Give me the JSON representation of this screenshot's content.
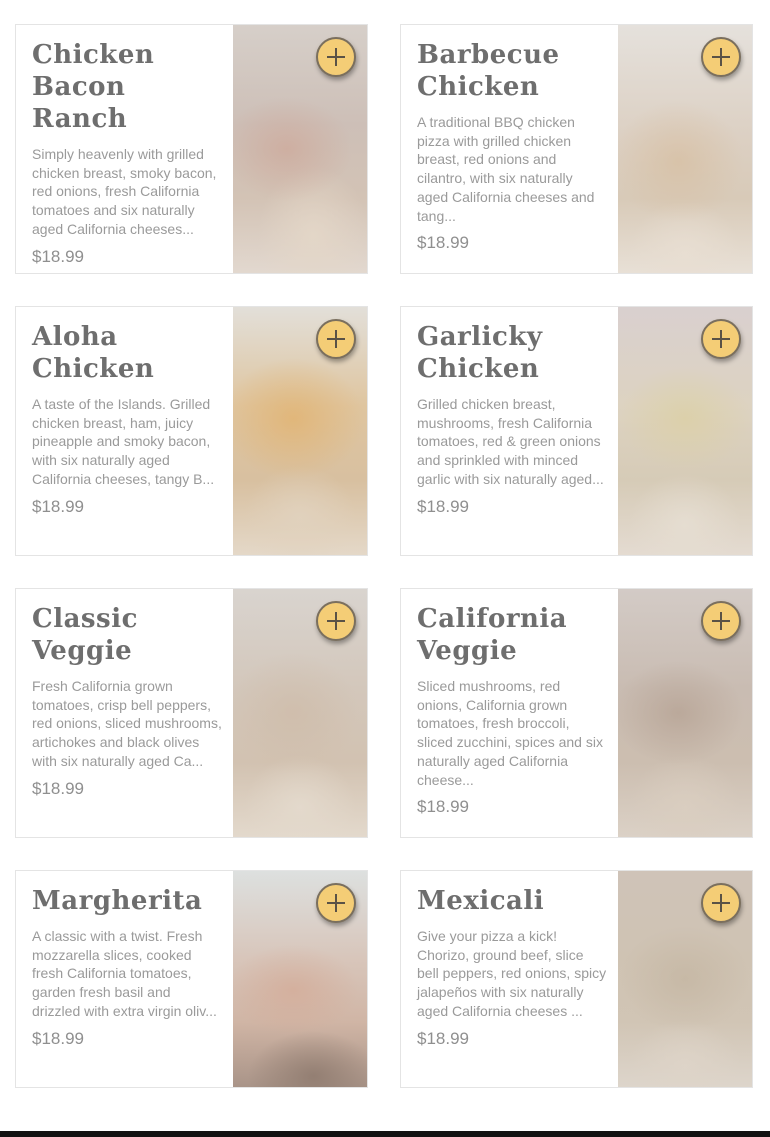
{
  "menu": {
    "items": [
      {
        "title": "Chicken Bacon Ranch",
        "description": "Simply heavenly with grilled chicken breast, smoky bacon, red onions, fresh California tomatoes and six naturally aged California cheeses...",
        "price": "$18.99",
        "add_icon": "plus-icon"
      },
      {
        "title": "Barbecue Chicken",
        "description": "A traditional BBQ chicken pizza with grilled chicken breast, red onions and cilantro, with six naturally aged California cheeses and tang...",
        "price": "$18.99",
        "add_icon": "plus-icon"
      },
      {
        "title": "Aloha Chicken",
        "description": "A taste of the Islands. Grilled chicken breast, ham, juicy pineapple and smoky bacon, with six naturally aged California cheeses, tangy B...",
        "price": "$18.99",
        "add_icon": "plus-icon"
      },
      {
        "title": "Garlicky Chicken",
        "description": "Grilled chicken breast, mushrooms, fresh California tomatoes, red & green onions and sprinkled with minced garlic with six naturally aged...",
        "price": "$18.99",
        "add_icon": "plus-icon"
      },
      {
        "title": "Classic Veggie",
        "description": "Fresh California grown tomatoes, crisp bell peppers, red onions, sliced mushrooms, artichokes and black olives with six naturally aged Ca...",
        "price": "$18.99",
        "add_icon": "plus-icon"
      },
      {
        "title": "California Veggie",
        "description": "Sliced mushrooms, red onions, California grown tomatoes, fresh broccoli, sliced zucchini, spices and six naturally aged California cheese...",
        "price": "$18.99",
        "add_icon": "plus-icon"
      },
      {
        "title": "Margherita",
        "description": "A classic with a twist. Fresh mozzarella slices, cooked fresh California tomatoes, garden fresh basil and drizzled with extra virgin oliv...",
        "price": "$18.99",
        "add_icon": "plus-icon"
      },
      {
        "title": "Mexicali",
        "description": "Give your pizza a kick! Chorizo, ground beef, slice bell peppers, red onions, spicy jalapeños with six naturally aged California cheeses ...",
        "price": "$18.99",
        "add_icon": "plus-icon"
      }
    ]
  },
  "colors": {
    "add_button": "#f4cd76",
    "title_text": "#6e6e6e",
    "body_text": "#9a9a9a",
    "card_border": "#e4e4e4"
  }
}
